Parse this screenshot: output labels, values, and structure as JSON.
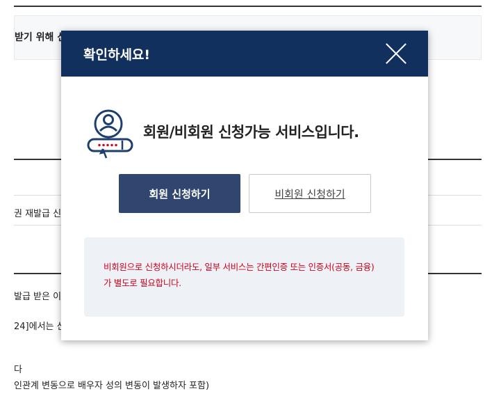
{
  "background": {
    "box_text": "받기 위해 신",
    "row1_text": "권 재발급 신청",
    "row2_text": "발급 받은 이력",
    "row3_text": "24]에서는 신",
    "row4_text": "다",
    "row5_text": "인관계 변동으로 배우자 성의 변동이 발생하자 포함)"
  },
  "modal": {
    "title": "확인하세요!",
    "message": "회원/비회원 신청가능 서비스입니다.",
    "member_button": "회원 신청하기",
    "nonmember_button": "비회원 신청하기",
    "notice_line1": "비회원으로 신청하시더라도, 일부 서비스는 간편인증 또는 인증서(공동, 금융)",
    "notice_line2": "가 별도로 필요합니다."
  },
  "colors": {
    "header_bg": "#12305e",
    "primary_button": "#31466f",
    "notice_bg": "#eef2f7",
    "notice_text": "#d0021b"
  }
}
